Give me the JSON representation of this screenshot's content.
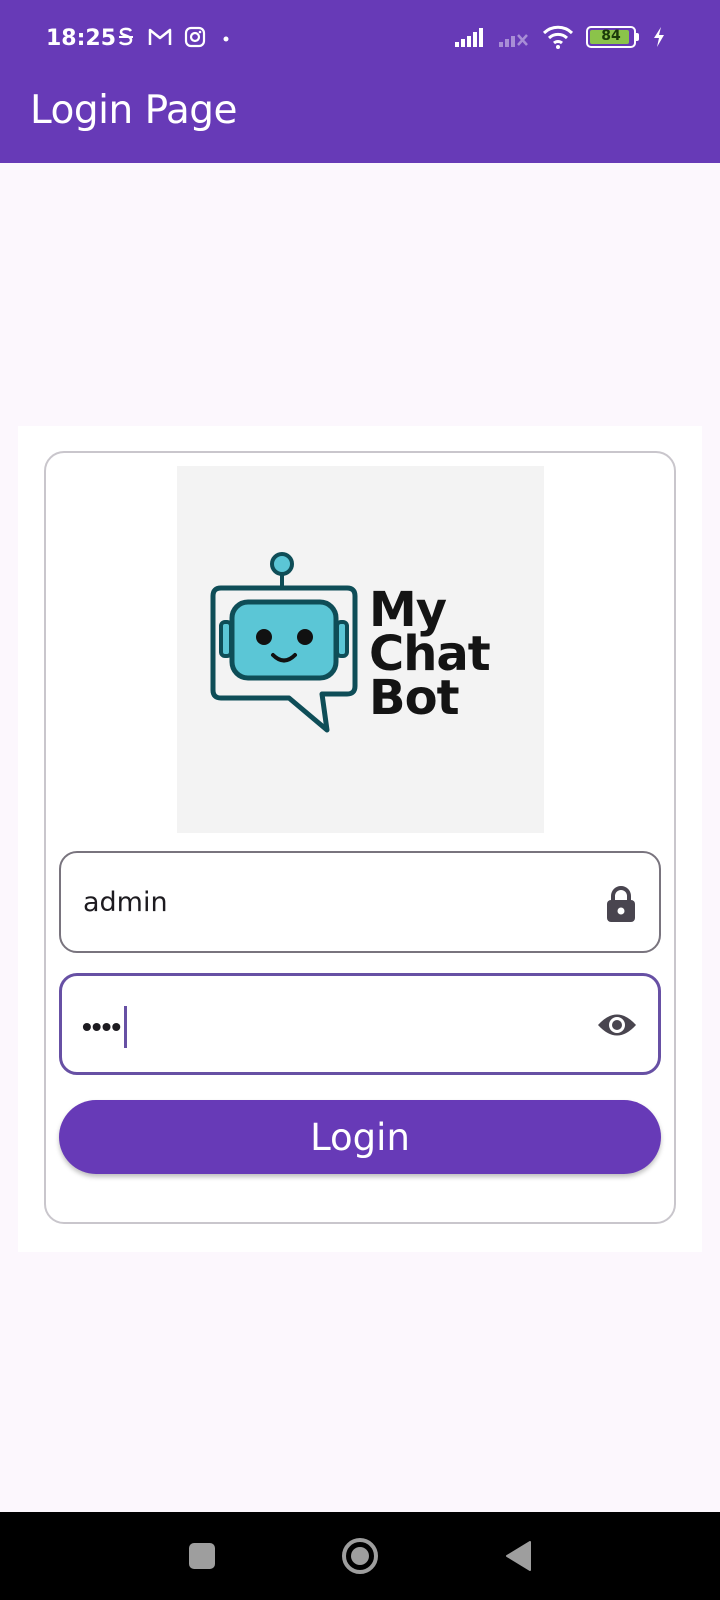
{
  "status_bar": {
    "time": "18:25",
    "left_icons": [
      "s-app-icon",
      "gmail-icon",
      "instagram-icon",
      "dot-icon"
    ],
    "battery_level": "84",
    "right_icons": [
      "signal-icon",
      "signal-no-service-icon",
      "wifi-icon",
      "battery-icon",
      "charging-icon"
    ]
  },
  "app_bar": {
    "title": "Login Page"
  },
  "logo": {
    "line1": "My",
    "line2": "Chat",
    "line3": "Bot"
  },
  "form": {
    "username_value": "admin",
    "username_icon": "lock-icon",
    "password_masked": "••••",
    "password_icon": "eye-icon",
    "login_label": "Login"
  },
  "nav_bar": {
    "buttons": [
      "recents-icon",
      "home-icon",
      "back-icon"
    ]
  },
  "colors": {
    "primary": "#673ab7",
    "background": "#fcf7fd",
    "focus_border": "#6750a4",
    "robot_face": "#5bc6d6",
    "robot_outline": "#0e4d57"
  }
}
